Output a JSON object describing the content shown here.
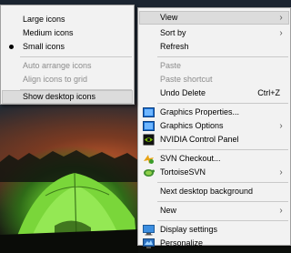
{
  "view_submenu": {
    "items": [
      {
        "label": "Large icons",
        "disabled": false
      },
      {
        "label": "Medium icons",
        "disabled": false
      },
      {
        "label": "Small icons",
        "disabled": false,
        "selected": true
      },
      {
        "label": "Auto arrange icons",
        "disabled": true
      },
      {
        "label": "Align icons to grid",
        "disabled": true
      },
      {
        "label": "Show desktop icons",
        "disabled": false,
        "highlighted": true
      }
    ]
  },
  "context_menu": {
    "view": "View",
    "sort_by": "Sort by",
    "refresh": "Refresh",
    "paste": "Paste",
    "paste_shortcut": "Paste shortcut",
    "undo_delete": "Undo Delete",
    "undo_delete_shortcut": "Ctrl+Z",
    "graphics_properties": "Graphics Properties...",
    "graphics_options": "Graphics Options",
    "nvidia_control_panel": "NVIDIA Control Panel",
    "svn_checkout": "SVN Checkout...",
    "tortoisesvn": "TortoiseSVN",
    "next_desktop_background": "Next desktop background",
    "new": "New",
    "display_settings": "Display settings",
    "personalize": "Personalize"
  },
  "colors": {
    "menu_background": "#f2f2f2",
    "highlight": "#dcdcdc",
    "disabled_text": "#8c8c8c"
  }
}
